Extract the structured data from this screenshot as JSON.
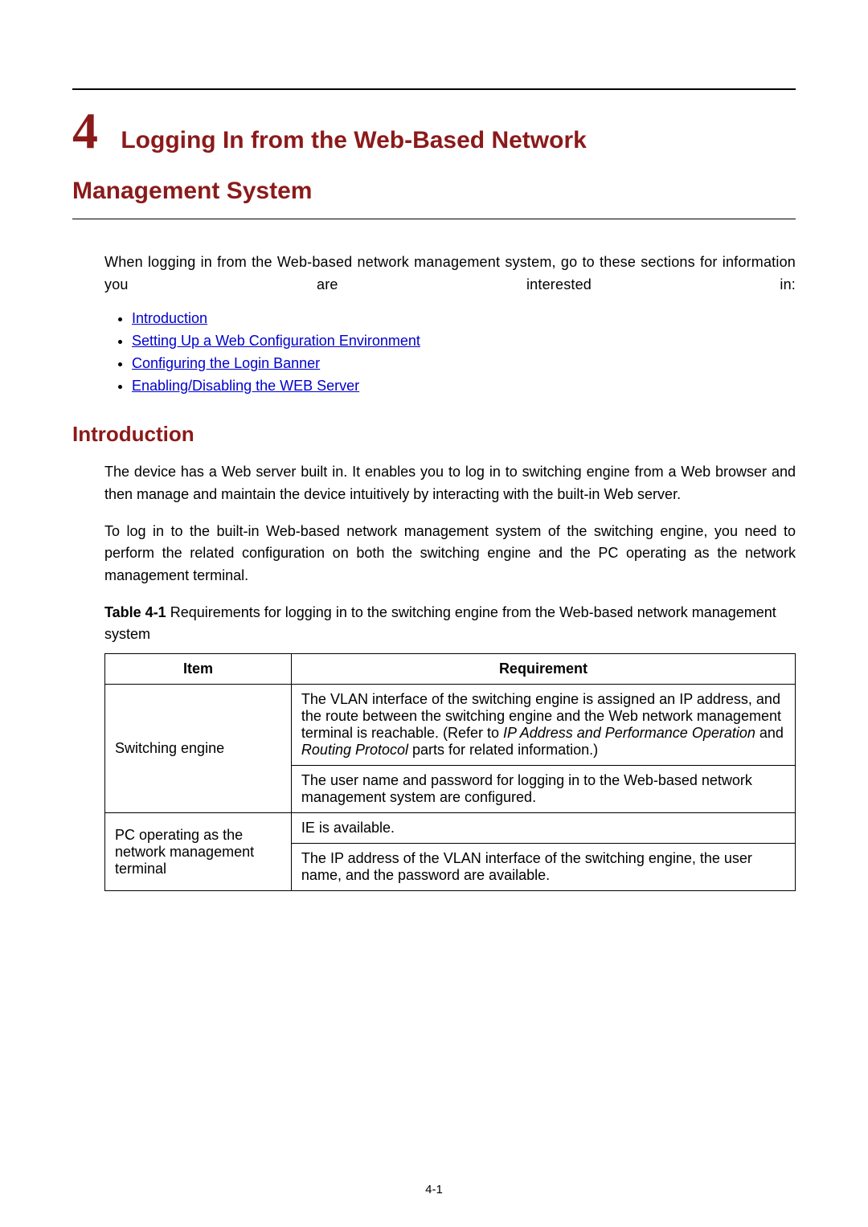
{
  "chapter": {
    "number": "4",
    "title_line1": "Logging In from the Web-Based Network",
    "title_line2": "Management System"
  },
  "intro_paragraph": "When logging in from the Web-based network management system, go to these sections for information you are interested in:",
  "toc": [
    "Introduction",
    "Setting Up a Web Configuration Environment",
    "Configuring the Login Banner",
    "Enabling/Disabling the WEB Server"
  ],
  "section_heading": "Introduction",
  "body": {
    "p1": "The device has a Web server built in. It enables you to log in to switching engine from a Web browser and then manage and maintain the device intuitively by interacting with the built-in Web server.",
    "p2": "To log in to the built-in Web-based network management system of the switching engine, you need to perform the related configuration on both the switching engine and the PC operating as the network management terminal."
  },
  "table": {
    "caption_label": "Table 4-1",
    "caption_text": " Requirements for logging in to the switching engine from the Web-based network management system",
    "headers": {
      "col1": "Item",
      "col2": "Requirement"
    },
    "rows": {
      "r1c1": "Switching engine",
      "r1c2_pre": "The VLAN interface of the switching engine is assigned an IP address, and the route between the switching engine and the Web network management terminal is reachable. (Refer to ",
      "r1c2_em1": "IP Address and Performance Operation",
      "r1c2_mid": " and ",
      "r1c2_em2": "Routing Protocol",
      "r1c2_post": " parts for related information.)",
      "r2c2": "The user name and password for logging in to the Web-based network management system are configured.",
      "r3c1": "PC operating as the network management terminal",
      "r3c2": "IE is available.",
      "r4c2": "The IP address of the VLAN interface of the switching engine, the user name, and the password are available."
    }
  },
  "page_number": "4-1"
}
